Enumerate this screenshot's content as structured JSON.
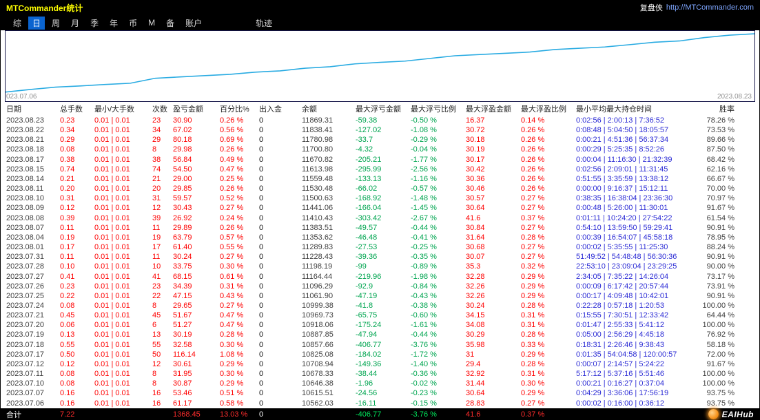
{
  "titlebar": {
    "title": "MTCommander统计",
    "brand": "复盘侠",
    "url": "http://MTCommander.com"
  },
  "menu": {
    "items": [
      "综",
      "日",
      "周",
      "月",
      "季",
      "年",
      "币",
      "M",
      "备",
      "账户"
    ],
    "active_index": 1,
    "extra": "轨迹"
  },
  "chart": {
    "label_left": "023.07.06",
    "label_right": "2023.08.23",
    "line_color": "#29abe2"
  },
  "chart_data": {
    "type": "line",
    "series_name": "余额",
    "x_start": "2023.07.06",
    "x_end": "2023.08.23",
    "values": [
      10500.86,
      10562.03,
      10615.51,
      10646.38,
      10678.33,
      10708.94,
      10825.08,
      10857.66,
      10887.85,
      10918.06,
      10969.73,
      10999.38,
      11061.9,
      11096.29,
      11164.44,
      11198.19,
      11228.43,
      11289.83,
      11353.62,
      11383.51,
      11410.43,
      11441.06,
      11500.63,
      11530.48,
      11559.48,
      11613.98,
      11670.82,
      11700.8,
      11780.98,
      11838.41,
      11869.31
    ],
    "ylim": [
      10450,
      11950
    ],
    "grid": false,
    "legend": "none"
  },
  "colors": {
    "profit_red": "#fe0000",
    "loss_green": "#00a550",
    "time_blue": "#2b2bd5",
    "line_cyan": "#29abe2",
    "active_tab_blue": "#0a64d0",
    "title_yellow": "#ffff00"
  },
  "table": {
    "headers": [
      "日期",
      "总手数",
      "最小/大手数",
      "次数",
      "盈亏金额",
      "百分比%",
      "出入金",
      "余额",
      "最大浮亏金额",
      "最大浮亏比例",
      "最大浮盈金额",
      "最大浮盈比例",
      "最小平均最大持仓时间",
      "胜率"
    ],
    "rows": [
      [
        "2023.08.23",
        "0.23",
        "0.01 | 0.01",
        "23",
        "30.90",
        "0.26 %",
        "0",
        "11869.31",
        "-59.38",
        "-0.50 %",
        "16.37",
        "0.14 %",
        "0:02:56 | 2:00:13 | 7:36:52",
        "78.26 %"
      ],
      [
        "2023.08.22",
        "0.34",
        "0.01 | 0.01",
        "34",
        "67.02",
        "0.56 %",
        "0",
        "11838.41",
        "-127.02",
        "-1.08 %",
        "30.72",
        "0.26 %",
        "0:08:48 | 5:04:50 | 18:05:57",
        "73.53 %"
      ],
      [
        "2023.08.21",
        "0.29",
        "0.01 | 0.01",
        "29",
        "80.18",
        "0.69 %",
        "0",
        "11780.98",
        "-33.7",
        "-0.29 %",
        "30.18",
        "0.26 %",
        "0:00:21 | 4:51:36 | 56:37:34",
        "89.66 %"
      ],
      [
        "2023.08.18",
        "0.08",
        "0.01 | 0.01",
        "8",
        "29.98",
        "0.26 %",
        "0",
        "11700.80",
        "-4.32",
        "-0.04 %",
        "30.19",
        "0.26 %",
        "0:00:29 | 5:25:35 | 8:52:26",
        "87.50 %"
      ],
      [
        "2023.08.17",
        "0.38",
        "0.01 | 0.01",
        "38",
        "56.84",
        "0.49 %",
        "0",
        "11670.82",
        "-205.21",
        "-1.77 %",
        "30.17",
        "0.26 %",
        "0:00:04 | 11:16:30 | 21:32:39",
        "68.42 %"
      ],
      [
        "2023.08.15",
        "0.74",
        "0.01 | 0.01",
        "74",
        "54.50",
        "0.47 %",
        "0",
        "11613.98",
        "-295.99",
        "-2.56 %",
        "30.42",
        "0.26 %",
        "0:02:56 | 2:09:01 | 11:31:45",
        "62.16 %"
      ],
      [
        "2023.08.14",
        "0.21",
        "0.01 | 0.01",
        "21",
        "29.00",
        "0.25 %",
        "0",
        "11559.48",
        "-133.13",
        "-1.16 %",
        "30.36",
        "0.26 %",
        "0:51:55 | 3:35:59 | 13:38:12",
        "66.67 %"
      ],
      [
        "2023.08.11",
        "0.20",
        "0.01 | 0.01",
        "20",
        "29.85",
        "0.26 %",
        "0",
        "11530.48",
        "-66.02",
        "-0.57 %",
        "30.46",
        "0.26 %",
        "0:00:00 | 9:16:37 | 15:12:11",
        "70.00 %"
      ],
      [
        "2023.08.10",
        "0.31",
        "0.01 | 0.01",
        "31",
        "59.57",
        "0.52 %",
        "0",
        "11500.63",
        "-168.92",
        "-1.48 %",
        "30.57",
        "0.27 %",
        "0:38:35 | 16:38:04 | 23:36:30",
        "70.97 %"
      ],
      [
        "2023.08.09",
        "0.12",
        "0.01 | 0.01",
        "12",
        "30.43",
        "0.27 %",
        "0",
        "11441.06",
        "-166.04",
        "-1.45 %",
        "30.64",
        "0.27 %",
        "0:00:48 | 5:26:00 | 11:30:01",
        "91.67 %"
      ],
      [
        "2023.08.08",
        "0.39",
        "0.01 | 0.01",
        "39",
        "26.92",
        "0.24 %",
        "0",
        "11410.43",
        "-303.42",
        "-2.67 %",
        "41.6",
        "0.37 %",
        "0:01:11 | 10:24:20 | 27:54:22",
        "61.54 %"
      ],
      [
        "2023.08.07",
        "0.11",
        "0.01 | 0.01",
        "11",
        "29.89",
        "0.26 %",
        "0",
        "11383.51",
        "-49.57",
        "-0.44 %",
        "30.84",
        "0.27 %",
        "0:54:10 | 13:59:50 | 59:29:41",
        "90.91 %"
      ],
      [
        "2023.08.04",
        "0.19",
        "0.01 | 0.01",
        "19",
        "63.79",
        "0.57 %",
        "0",
        "11353.62",
        "-46.48",
        "-0.41 %",
        "31.64",
        "0.28 %",
        "0:00:39 | 16:54:07 | 45:58:18",
        "78.95 %"
      ],
      [
        "2023.08.01",
        "0.17",
        "0.01 | 0.01",
        "17",
        "61.40",
        "0.55 %",
        "0",
        "11289.83",
        "-27.53",
        "-0.25 %",
        "30.68",
        "0.27 %",
        "0:00:02 | 5:35:55 | 11:25:30",
        "88.24 %"
      ],
      [
        "2023.07.31",
        "0.11",
        "0.01 | 0.01",
        "11",
        "30.24",
        "0.27 %",
        "0",
        "11228.43",
        "-39.36",
        "-0.35 %",
        "30.07",
        "0.27 %",
        "51:49:52 | 54:48:48 | 56:30:36",
        "90.91 %"
      ],
      [
        "2023.07.28",
        "0.10",
        "0.01 | 0.01",
        "10",
        "33.75",
        "0.30 %",
        "0",
        "11198.19",
        "-99",
        "-0.89 %",
        "35.3",
        "0.32 %",
        "22:53:10 | 23:09:04 | 23:29:25",
        "90.00 %"
      ],
      [
        "2023.07.27",
        "0.41",
        "0.01 | 0.01",
        "41",
        "68.15",
        "0.61 %",
        "0",
        "11164.44",
        "-219.96",
        "-1.98 %",
        "32.28",
        "0.29 %",
        "2:34:05 | 7:35:22 | 14:26:04",
        "73.17 %"
      ],
      [
        "2023.07.26",
        "0.23",
        "0.01 | 0.01",
        "23",
        "34.39",
        "0.31 %",
        "0",
        "11096.29",
        "-92.9",
        "-0.84 %",
        "32.26",
        "0.29 %",
        "0:00:09 | 6:17:42 | 20:57:44",
        "73.91 %"
      ],
      [
        "2023.07.25",
        "0.22",
        "0.01 | 0.01",
        "22",
        "47.15",
        "0.43 %",
        "0",
        "11061.90",
        "-47.19",
        "-0.43 %",
        "32.26",
        "0.29 %",
        "0:00:17 | 4:09:48 | 10:42:01",
        "90.91 %"
      ],
      [
        "2023.07.24",
        "0.08",
        "0.01 | 0.01",
        "8",
        "29.65",
        "0.27 %",
        "0",
        "10999.38",
        "-41.8",
        "-0.38 %",
        "30.24",
        "0.28 %",
        "0:22:28 | 0:57:18 | 1:20:53",
        "100.00 %"
      ],
      [
        "2023.07.21",
        "0.45",
        "0.01 | 0.01",
        "45",
        "51.67",
        "0.47 %",
        "0",
        "10969.73",
        "-65.75",
        "-0.60 %",
        "34.15",
        "0.31 %",
        "0:15:55 | 7:30:51 | 12:33:42",
        "64.44 %"
      ],
      [
        "2023.07.20",
        "0.06",
        "0.01 | 0.01",
        "6",
        "51.27",
        "0.47 %",
        "0",
        "10918.06",
        "-175.24",
        "-1.61 %",
        "34.08",
        "0.31 %",
        "0:01:47 | 2:55:33 | 5:41:12",
        "100.00 %"
      ],
      [
        "2023.07.19",
        "0.13",
        "0.01 | 0.01",
        "13",
        "30.19",
        "0.28 %",
        "0",
        "10887.85",
        "-47.94",
        "-0.44 %",
        "30.29",
        "0.28 %",
        "0:05:00 | 2:56:29 | 4:45:18",
        "76.92 %"
      ],
      [
        "2023.07.18",
        "0.55",
        "0.01 | 0.01",
        "55",
        "32.58",
        "0.30 %",
        "0",
        "10857.66",
        "-406.77",
        "-3.76 %",
        "35.98",
        "0.33 %",
        "0:18:31 | 2:26:46 | 9:38:43",
        "58.18 %"
      ],
      [
        "2023.07.17",
        "0.50",
        "0.01 | 0.01",
        "50",
        "116.14",
        "1.08 %",
        "0",
        "10825.08",
        "-184.02",
        "-1.72 %",
        "31",
        "0.29 %",
        "0:01:35 | 54:04:58 | 120:00:57",
        "72.00 %"
      ],
      [
        "2023.07.12",
        "0.12",
        "0.01 | 0.01",
        "12",
        "30.61",
        "0.29 %",
        "0",
        "10708.94",
        "-149.36",
        "-1.40 %",
        "29.4",
        "0.28 %",
        "0:00:07 | 2:14:57 | 5:24:22",
        "91.67 %"
      ],
      [
        "2023.07.11",
        "0.08",
        "0.01 | 0.01",
        "8",
        "31.95",
        "0.30 %",
        "0",
        "10678.33",
        "-38.44",
        "-0.36 %",
        "32.92",
        "0.31 %",
        "5:17:12 | 5:37:16 | 5:51:46",
        "100.00 %"
      ],
      [
        "2023.07.10",
        "0.08",
        "0.01 | 0.01",
        "8",
        "30.87",
        "0.29 %",
        "0",
        "10646.38",
        "-1.96",
        "-0.02 %",
        "31.44",
        "0.30 %",
        "0:00:21 | 0:16:27 | 0:37:04",
        "100.00 %"
      ],
      [
        "2023.07.07",
        "0.16",
        "0.01 | 0.01",
        "16",
        "53.46",
        "0.51 %",
        "0",
        "10615.51",
        "-24.56",
        "-0.23 %",
        "30.64",
        "0.29 %",
        "0:04:29 | 3:36:06 | 17:56:19",
        "93.75 %"
      ],
      [
        "2023.07.06",
        "0.16",
        "0.01 | 0.01",
        "16",
        "61.17",
        "0.58 %",
        "0",
        "10562.03",
        "-16.11",
        "-0.15 %",
        "28.83",
        "0.27 %",
        "0:00:02 | 0:16:00 | 0:36:12",
        "93.75 %"
      ]
    ],
    "total": [
      "合计",
      "7.22",
      "",
      "",
      "1368.45",
      "13.03 %",
      "0",
      "",
      "-406.77",
      "-3.76 %",
      "41.6",
      "0.37 %",
      "",
      ""
    ]
  },
  "footer": {
    "logo_text": "EAIHub"
  }
}
